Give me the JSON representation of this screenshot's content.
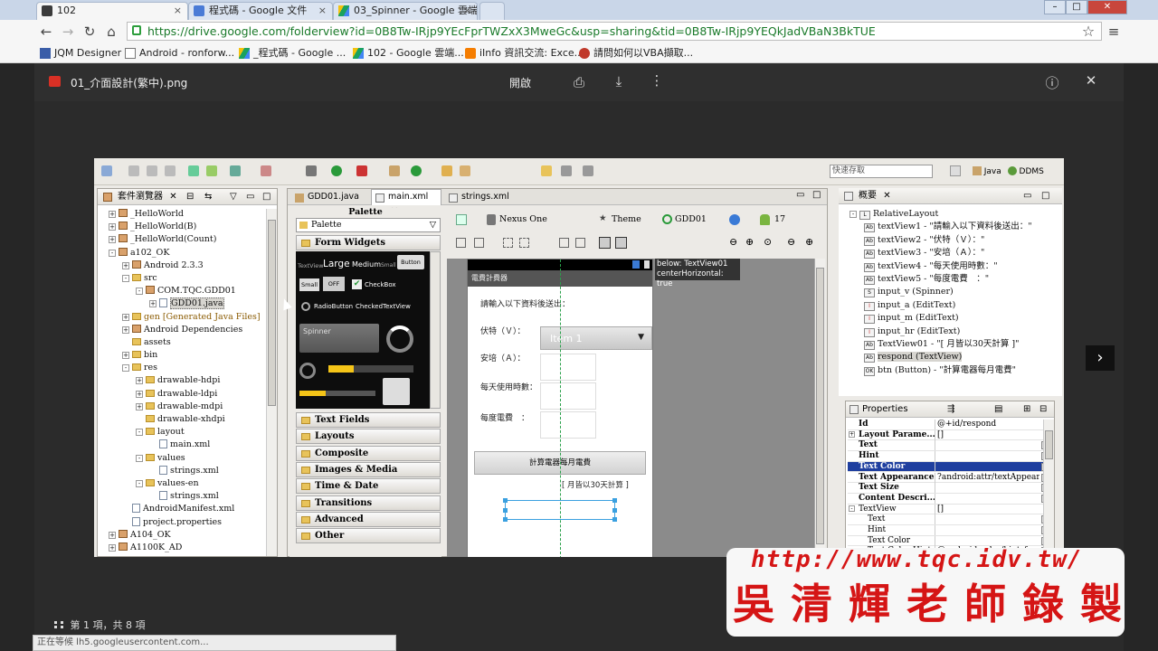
{
  "browser": {
    "tabs": [
      {
        "label": "102",
        "active": true
      },
      {
        "label": "程式碼 - Google 文件",
        "active": false
      },
      {
        "label": "03_Spinner - Google 雲端",
        "active": false
      }
    ],
    "url": "https://drive.google.com/folderview?id=0B8Tw-IRjp9YEcFprTWZxX3MweGc&usp=sharing&tid=0B8Tw-IRjp9YEQkJadVBaN3BkTUE",
    "bookmarks": [
      "JQM Designer",
      "Android - ronforw...",
      "_程式碼 - Google ...",
      "102 - Google 雲端...",
      "iInfo 資訊交流: Exce...",
      "請問如何以VBA擷取..."
    ]
  },
  "viewer": {
    "file_name": "01_介面設計(繁中).png",
    "open_label": "開啟",
    "counter": "第 1 項，共 8 項",
    "status": "正在等候 lh5.googleusercontent.com..."
  },
  "eclipse": {
    "quick_access": "快速存取",
    "perspectives": [
      "Java",
      "DDMS"
    ],
    "explorer_title": "套件瀏覽器",
    "tree": [
      {
        "label": "_HelloWorld",
        "d": 0,
        "ic": "pk",
        "e": "+"
      },
      {
        "label": "_HelloWorld(B)",
        "d": 0,
        "ic": "pk",
        "e": "+"
      },
      {
        "label": "_HelloWorld(Count)",
        "d": 0,
        "ic": "pk",
        "e": "+"
      },
      {
        "label": "a102_OK",
        "d": 0,
        "ic": "pk",
        "e": "-"
      },
      {
        "label": "Android 2.3.3",
        "d": 1,
        "ic": "pk",
        "e": "+"
      },
      {
        "label": "src",
        "d": 1,
        "ic": "fi",
        "e": "-"
      },
      {
        "label": "COM.TQC.GDD01",
        "d": 2,
        "ic": "pk",
        "e": "-"
      },
      {
        "label": "GDD01.java",
        "d": 3,
        "ic": "fl",
        "e": "+",
        "sel": true
      },
      {
        "label": "gen [Generated Java Files]",
        "d": 1,
        "ic": "fi",
        "e": "+"
      },
      {
        "label": "Android Dependencies",
        "d": 1,
        "ic": "pk",
        "e": "+"
      },
      {
        "label": "assets",
        "d": 1,
        "ic": "fi",
        "e": ""
      },
      {
        "label": "bin",
        "d": 1,
        "ic": "fi",
        "e": "+"
      },
      {
        "label": "res",
        "d": 1,
        "ic": "fi",
        "e": "-"
      },
      {
        "label": "drawable-hdpi",
        "d": 2,
        "ic": "fi",
        "e": "+"
      },
      {
        "label": "drawable-ldpi",
        "d": 2,
        "ic": "fi",
        "e": "+"
      },
      {
        "label": "drawable-mdpi",
        "d": 2,
        "ic": "fi",
        "e": "+"
      },
      {
        "label": "drawable-xhdpi",
        "d": 2,
        "ic": "fi",
        "e": ""
      },
      {
        "label": "layout",
        "d": 2,
        "ic": "fi",
        "e": "-"
      },
      {
        "label": "main.xml",
        "d": 3,
        "ic": "fl",
        "e": ""
      },
      {
        "label": "values",
        "d": 2,
        "ic": "fi",
        "e": "-"
      },
      {
        "label": "strings.xml",
        "d": 3,
        "ic": "fl",
        "e": ""
      },
      {
        "label": "values-en",
        "d": 2,
        "ic": "fi",
        "e": "-"
      },
      {
        "label": "strings.xml",
        "d": 3,
        "ic": "fl",
        "e": ""
      },
      {
        "label": "AndroidManifest.xml",
        "d": 1,
        "ic": "fl",
        "e": ""
      },
      {
        "label": "project.properties",
        "d": 1,
        "ic": "fl",
        "e": ""
      },
      {
        "label": "A104_OK",
        "d": 0,
        "ic": "pk",
        "e": "+"
      },
      {
        "label": "A1100K_AD",
        "d": 0,
        "ic": "pk",
        "e": "+"
      }
    ],
    "editor_tabs": [
      "GDD01.java",
      "main.xml",
      "strings.xml"
    ],
    "palette_title": "Palette",
    "palette_dropdown": "Palette",
    "form_widgets": "Form Widgets",
    "widget_samples": {
      "textview": "TextView",
      "large": "Large",
      "medium": "Medium",
      "small_text": "Small",
      "button": "Button",
      "small_btn": "Small",
      "off": "OFF",
      "checkbox": "CheckBox",
      "radio": "RadioButton",
      "checked": "CheckedTextView",
      "spinner": "Spinner"
    },
    "palette_groups": [
      "Text Fields",
      "Layouts",
      "Composite",
      "Images & Media",
      "Time & Date",
      "Transitions",
      "Advanced",
      "Other"
    ],
    "layout_toolbar": {
      "device": "Nexus One",
      "theme": "Theme",
      "activity": "GDD01",
      "api": "17"
    },
    "tooltip": [
      "below: TextView01",
      "centerHorizontal: true"
    ],
    "phone": {
      "title": "電費計費器",
      "prompt": "請輸入以下資料後送出：",
      "labels": [
        "伏特（Ｖ）：",
        "安培（Ａ）：",
        "每天使用時數：",
        "每度電費　："
      ],
      "spinner_value": "Item 1",
      "button": "計算電器每月電費",
      "result": "[ 月皆以30天計算 ]"
    },
    "outline_title": "概要",
    "outline": [
      {
        "label": "RelativeLayout",
        "d": 0,
        "k": "L"
      },
      {
        "label": "textView1 - \"請輸入以下資料後送出：\"",
        "d": 1,
        "k": "Ab"
      },
      {
        "label": "textView2 - \"伏特（Ｖ）：\"",
        "d": 1,
        "k": "Ab"
      },
      {
        "label": "textView3 - \"安培（Ａ）：\"",
        "d": 1,
        "k": "Ab"
      },
      {
        "label": "textView4 - \"每天使用時數：\"",
        "d": 1,
        "k": "Ab"
      },
      {
        "label": "textView5 - \"每度電費　：\"",
        "d": 1,
        "k": "Ab"
      },
      {
        "label": "input_v (Spinner)",
        "d": 1,
        "k": "S"
      },
      {
        "label": "input_a (EditText)",
        "d": 1,
        "k": "I"
      },
      {
        "label": "input_m (EditText)",
        "d": 1,
        "k": "I"
      },
      {
        "label": "input_hr (EditText)",
        "d": 1,
        "k": "I"
      },
      {
        "label": "TextView01 - \"[ 月皆以30天計算 ]\"",
        "d": 1,
        "k": "Ab"
      },
      {
        "label": "respond (TextView)",
        "d": 1,
        "k": "Ab",
        "sel": true
      },
      {
        "label": "btn (Button) - \"計算電器每月電費\"",
        "d": 1,
        "k": "OK"
      }
    ],
    "properties_title": "Properties",
    "properties": [
      {
        "k": "Id",
        "v": "@+id/respond",
        "bold": true
      },
      {
        "k": "Layout Parame...",
        "v": "[]",
        "bold": true,
        "exp": "+"
      },
      {
        "k": "Text",
        "v": "",
        "bold": true,
        "dots": true
      },
      {
        "k": "Hint",
        "v": "",
        "bold": true,
        "dots": true
      },
      {
        "k": "Text Color",
        "v": "",
        "bold": true,
        "dots": true,
        "sel": true
      },
      {
        "k": "Text Appearance",
        "v": "?android:attr/textAppeara...",
        "bold": true,
        "dots": true
      },
      {
        "k": "Text Size",
        "v": "",
        "bold": true,
        "dots": true
      },
      {
        "k": "Content Descri...",
        "v": "",
        "bold": true,
        "dots": true
      },
      {
        "k": "TextView",
        "v": "[]",
        "bold": false,
        "exp": "-"
      },
      {
        "k": "Text",
        "v": "",
        "bold": false,
        "dots": true,
        "indent": true
      },
      {
        "k": "Hint",
        "v": "",
        "bold": false,
        "dots": true,
        "indent": true
      },
      {
        "k": "Text Color",
        "v": "",
        "bold": false,
        "dots": true,
        "indent": true
      },
      {
        "k": "Text Color Hint",
        "v": "@android:color/hint_f...",
        "bold": false,
        "dots": true,
        "indent": true
      }
    ]
  },
  "watermark": {
    "url": "http://www.tqc.idv.tw/",
    "name": "吳清輝老師錄製"
  },
  "colors": {
    "watermark_red": "#d51515",
    "selection_blue": "#1f3f9f",
    "accent_green": "#27a34a"
  }
}
